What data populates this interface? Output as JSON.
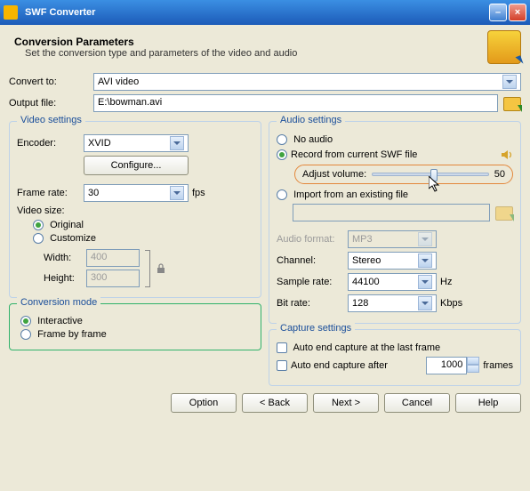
{
  "window": {
    "title": "SWF Converter"
  },
  "header": {
    "title": "Conversion Parameters",
    "subtitle": "Set the conversion type and parameters of the video and audio"
  },
  "convert": {
    "label": "Convert to:",
    "value": "AVI video"
  },
  "output": {
    "label": "Output file:",
    "value": "E:\\bowman.avi"
  },
  "video": {
    "legend": "Video settings",
    "encoder_label": "Encoder:",
    "encoder_value": "XVID",
    "configure": "Configure...",
    "framerate_label": "Frame rate:",
    "framerate_value": "30",
    "framerate_unit": "fps",
    "size_label": "Video size:",
    "original": "Original",
    "customize": "Customize",
    "width_label": "Width:",
    "width_value": "400",
    "height_label": "Height:",
    "height_value": "300"
  },
  "audio": {
    "legend": "Audio settings",
    "no_audio": "No audio",
    "record": "Record from current SWF file",
    "adjust_label": "Adjust volume:",
    "adjust_value": "50",
    "import": "Import from an existing file",
    "import_path": "",
    "format_label": "Audio format:",
    "format_value": "MP3",
    "channel_label": "Channel:",
    "channel_value": "Stereo",
    "sample_label": "Sample rate:",
    "sample_value": "44100",
    "sample_unit": "Hz",
    "bitrate_label": "Bit rate:",
    "bitrate_value": "128",
    "bitrate_unit": "Kbps"
  },
  "mode": {
    "legend": "Conversion mode",
    "interactive": "Interactive",
    "framebyframe": "Frame by frame"
  },
  "capture": {
    "legend": "Capture settings",
    "auto_last": "Auto end capture at the last frame",
    "auto_after": "Auto end capture after",
    "after_value": "1000",
    "after_unit": "frames"
  },
  "buttons": {
    "option": "Option",
    "back": "< Back",
    "next": "Next >",
    "cancel": "Cancel",
    "help": "Help"
  }
}
